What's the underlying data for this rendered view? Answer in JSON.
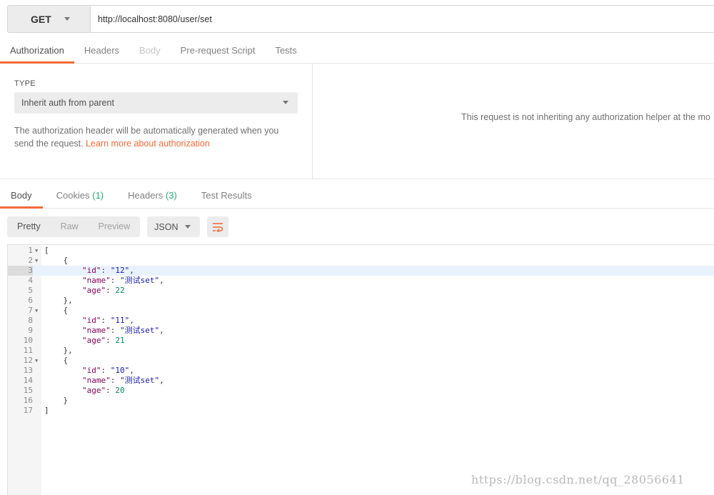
{
  "request": {
    "method": "GET",
    "url": "http://localhost:8080/user/set"
  },
  "request_tabs": [
    {
      "label": "Authorization",
      "state": "active"
    },
    {
      "label": "Headers",
      "state": "normal"
    },
    {
      "label": "Body",
      "state": "disabled"
    },
    {
      "label": "Pre-request Script",
      "state": "normal"
    },
    {
      "label": "Tests",
      "state": "normal"
    }
  ],
  "auth": {
    "type_label": "TYPE",
    "type_value": "Inherit auth from parent",
    "description": "The authorization header will be automatically generated when you send the request.",
    "learn_more": "Learn more about authorization",
    "right_message": "This request is not inheriting any authorization helper at the mo"
  },
  "response_tabs": [
    {
      "label": "Body",
      "count": "",
      "state": "active"
    },
    {
      "label": "Cookies",
      "count": "(1)",
      "state": "normal"
    },
    {
      "label": "Headers",
      "count": "(3)",
      "state": "normal"
    },
    {
      "label": "Test Results",
      "count": "",
      "state": "normal"
    }
  ],
  "toolbar": {
    "views": [
      "Pretty",
      "Raw",
      "Preview"
    ],
    "active_view": "Pretty",
    "format": "JSON",
    "wrap_icon": "wrap-lines-icon"
  },
  "response_body": [
    {
      "n": "1",
      "fold": true,
      "text": "["
    },
    {
      "n": "2",
      "fold": true,
      "text": "    {"
    },
    {
      "n": "3",
      "fold": false,
      "text": "        \"id\": \"12\",",
      "highlight": true
    },
    {
      "n": "4",
      "fold": false,
      "text": "        \"name\": \"测试set\","
    },
    {
      "n": "5",
      "fold": false,
      "text": "        \"age\": 22"
    },
    {
      "n": "6",
      "fold": false,
      "text": "    },"
    },
    {
      "n": "7",
      "fold": true,
      "text": "    {"
    },
    {
      "n": "8",
      "fold": false,
      "text": "        \"id\": \"11\","
    },
    {
      "n": "9",
      "fold": false,
      "text": "        \"name\": \"测试set\","
    },
    {
      "n": "10",
      "fold": false,
      "text": "        \"age\": 21"
    },
    {
      "n": "11",
      "fold": false,
      "text": "    },"
    },
    {
      "n": "12",
      "fold": true,
      "text": "    {"
    },
    {
      "n": "13",
      "fold": false,
      "text": "        \"id\": \"10\","
    },
    {
      "n": "14",
      "fold": false,
      "text": "        \"name\": \"测试set\","
    },
    {
      "n": "15",
      "fold": false,
      "text": "        \"age\": 20"
    },
    {
      "n": "16",
      "fold": false,
      "text": "    }"
    },
    {
      "n": "17",
      "fold": false,
      "text": "]"
    }
  ],
  "watermark": "https://blog.csdn.net/qq_28056641",
  "colors": {
    "accent": "#f26b3a",
    "count": "#2ea873"
  }
}
